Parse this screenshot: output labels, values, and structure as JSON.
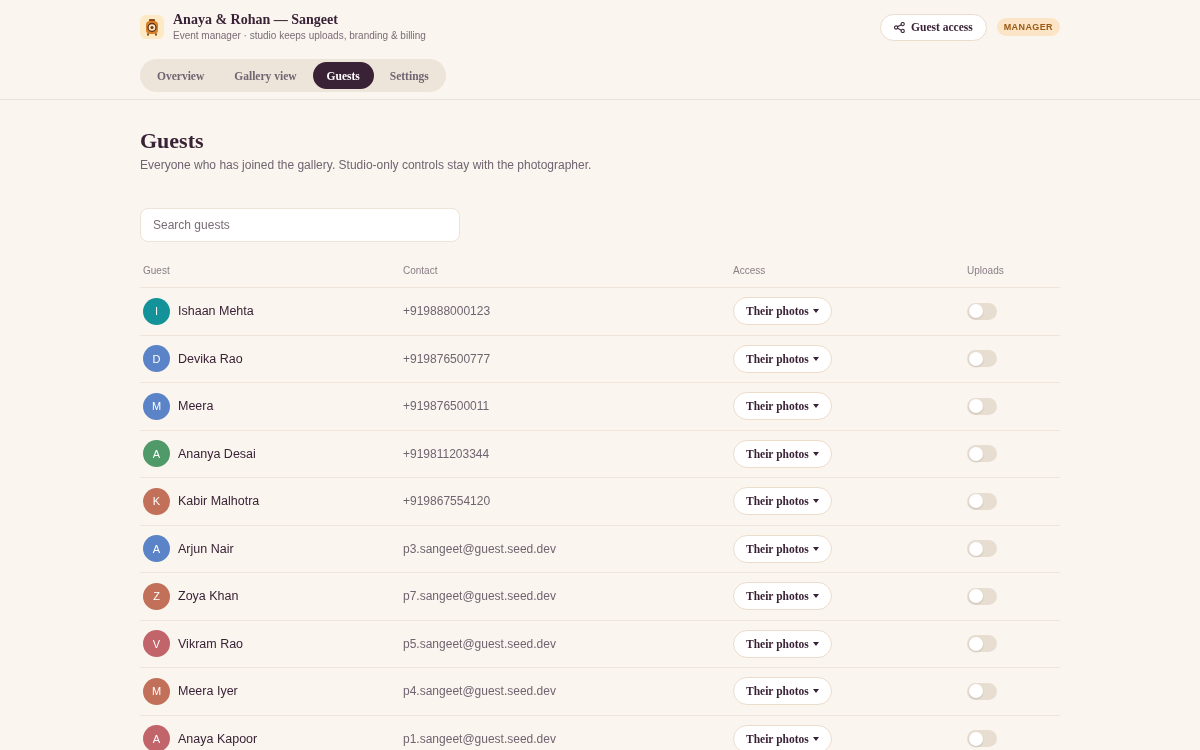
{
  "header": {
    "title": "Anaya & Rohan — Sangeet",
    "subtitle": "Event manager · studio keeps uploads, branding & billing",
    "share_button": "Guest access",
    "role_badge": "MANAGER"
  },
  "tabs": [
    {
      "label": "Overview",
      "selected": false
    },
    {
      "label": "Gallery view",
      "selected": false
    },
    {
      "label": "Guests",
      "selected": true
    },
    {
      "label": "Settings",
      "selected": false
    }
  ],
  "page": {
    "heading": "Guests",
    "description": "Everyone who has joined the gallery. Studio-only controls stay with the photographer.",
    "search": {
      "placeholder": "Search guests"
    }
  },
  "table": {
    "columns": [
      "Guest",
      "Contact",
      "Access",
      "Uploads"
    ],
    "rows": [
      {
        "initial": "I",
        "color": "#14929a",
        "name": "Ishaan Mehta",
        "contact": "+919888000123",
        "access": "Their photos",
        "uploads_on": false
      },
      {
        "initial": "D",
        "color": "#5b83c8",
        "name": "Devika Rao",
        "contact": "+919876500777",
        "access": "Their photos",
        "uploads_on": false
      },
      {
        "initial": "M",
        "color": "#5b83c8",
        "name": "Meera",
        "contact": "+919876500011",
        "access": "Their photos",
        "uploads_on": false
      },
      {
        "initial": "A",
        "color": "#4f9a68",
        "name": "Ananya Desai",
        "contact": "+919811203344",
        "access": "Their photos",
        "uploads_on": false
      },
      {
        "initial": "K",
        "color": "#c2705a",
        "name": "Kabir Malhotra",
        "contact": "+919867554120",
        "access": "Their photos",
        "uploads_on": false
      },
      {
        "initial": "A",
        "color": "#5b83c8",
        "name": "Arjun Nair",
        "contact": "p3.sangeet@guest.seed.dev",
        "access": "Their photos",
        "uploads_on": false
      },
      {
        "initial": "Z",
        "color": "#c2705a",
        "name": "Zoya Khan",
        "contact": "p7.sangeet@guest.seed.dev",
        "access": "Their photos",
        "uploads_on": false
      },
      {
        "initial": "V",
        "color": "#c1656b",
        "name": "Vikram Rao",
        "contact": "p5.sangeet@guest.seed.dev",
        "access": "Their photos",
        "uploads_on": false
      },
      {
        "initial": "M",
        "color": "#c2705a",
        "name": "Meera Iyer",
        "contact": "p4.sangeet@guest.seed.dev",
        "access": "Their photos",
        "uploads_on": false
      },
      {
        "initial": "A",
        "color": "#c1656b",
        "name": "Anaya Kapoor",
        "contact": "p1.sangeet@guest.seed.dev",
        "access": "Their photos",
        "uploads_on": false
      }
    ]
  }
}
